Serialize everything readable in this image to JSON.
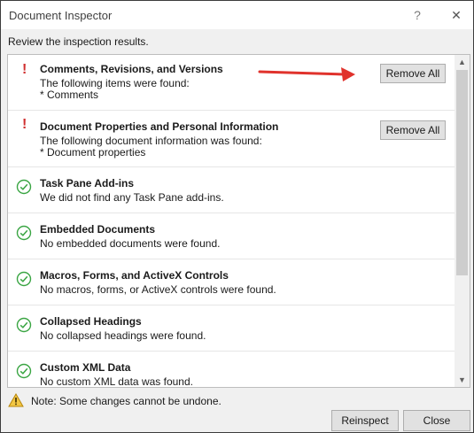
{
  "window": {
    "title": "Document Inspector",
    "help_label": "?",
    "close_label": "✕"
  },
  "instructions": "Review the inspection results.",
  "results": [
    {
      "status": "found",
      "title": "Comments, Revisions, and Versions",
      "line1": "The following items were found:",
      "line2": "* Comments",
      "action": "Remove All"
    },
    {
      "status": "found",
      "title": "Document Properties and Personal Information",
      "line1": "The following document information was found:",
      "line2": "* Document properties",
      "action": "Remove All"
    },
    {
      "status": "ok",
      "title": "Task Pane Add-ins",
      "line1": "We did not find any Task Pane add-ins."
    },
    {
      "status": "ok",
      "title": "Embedded Documents",
      "line1": "No embedded documents were found."
    },
    {
      "status": "ok",
      "title": "Macros, Forms, and ActiveX Controls",
      "line1": "No macros, forms, or ActiveX controls were found."
    },
    {
      "status": "ok",
      "title": "Collapsed Headings",
      "line1": "No collapsed headings were found."
    },
    {
      "status": "ok",
      "title": "Custom XML Data",
      "line1": "No custom XML data was found."
    }
  ],
  "note": "Note: Some changes cannot be undone.",
  "buttons": {
    "reinspect": "Reinspect",
    "close": "Close"
  },
  "colors": {
    "warning_mark": "#d03030",
    "ok_check": "#3aa543",
    "annotation_arrow": "#e0322c"
  }
}
